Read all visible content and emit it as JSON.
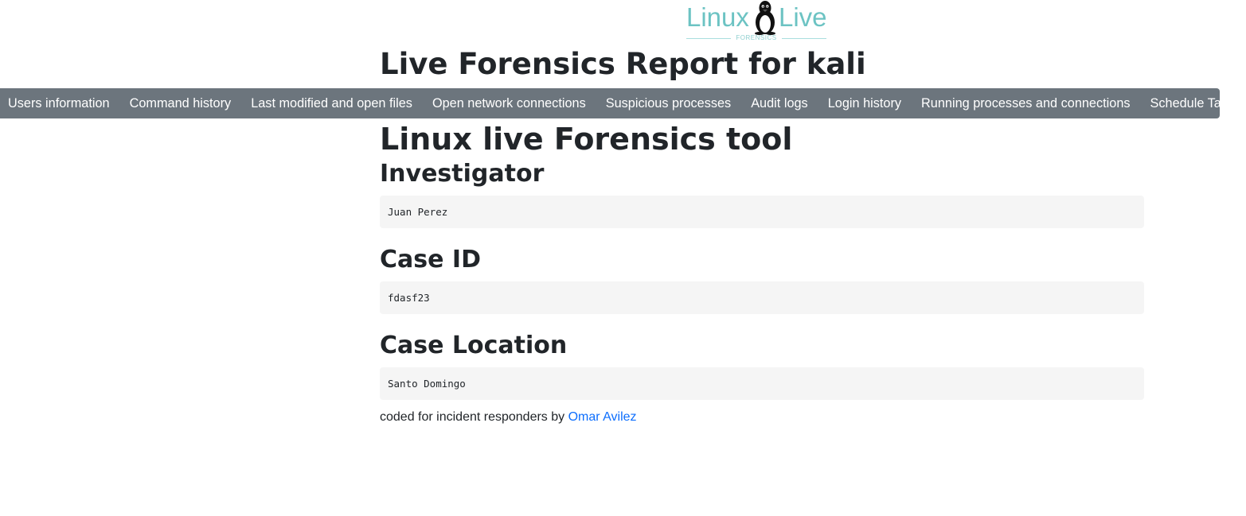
{
  "logo": {
    "left_text": "Linux",
    "right_text": "Live",
    "subtitle": "FORENSICS",
    "icon": "penguin-icon"
  },
  "report_title": "Live Forensics Report for kali",
  "nav": {
    "items": [
      {
        "label": "Users information"
      },
      {
        "label": "Command history"
      },
      {
        "label": "Last modified and open files"
      },
      {
        "label": "Open network connections"
      },
      {
        "label": "Suspicious processes"
      },
      {
        "label": "Audit logs"
      },
      {
        "label": "Login history"
      },
      {
        "label": "Running processes and connections"
      },
      {
        "label": "Schedule Tasks"
      }
    ]
  },
  "main": {
    "tool_title": "Linux live Forensics tool",
    "sections": [
      {
        "heading": "Investigator",
        "value": "Juan Perez"
      },
      {
        "heading": "Case ID",
        "value": "fdasf23"
      },
      {
        "heading": "Case Location",
        "value": "Santo Domingo"
      }
    ]
  },
  "footer": {
    "text": "coded for incident responders by ",
    "author": "Omar Avilez"
  },
  "colors": {
    "navbar": "#6c757d",
    "logo": "#6cc3c3",
    "link": "#0d6efd",
    "field_bg": "#f5f5f5"
  }
}
